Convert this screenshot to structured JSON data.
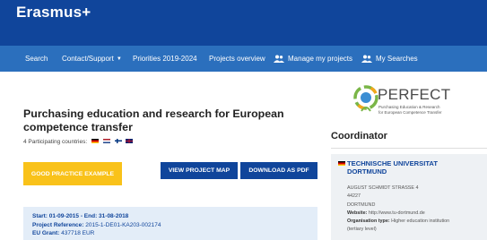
{
  "header": {
    "brand": "Erasmus+"
  },
  "nav": {
    "search": "Search",
    "contact": "Contact/Support",
    "priorities": "Priorities 2019-2024",
    "projects_overview": "Projects overview",
    "manage_projects": "Manage my projects",
    "my_searches": "My Searches"
  },
  "project": {
    "title": "Purchasing education and research for European competence transfer",
    "countries_label": "4 Participating countries:",
    "countries": [
      "de",
      "nl",
      "fi",
      "gb"
    ]
  },
  "buttons": {
    "good_practice": "GOOD PRACTICE EXAMPLE",
    "view_map": "VIEW PROJECT MAP",
    "download_pdf": "DOWNLOAD AS PDF"
  },
  "details": {
    "dates": "Start: 01-09-2015 - End: 31-08-2018",
    "reference_label": "Project Reference:",
    "reference": "2015-1-DE01-KA203-002174",
    "grant_label": "EU Grant:",
    "grant": "437718 EUR"
  },
  "logo": {
    "word": "PERFECT",
    "subtitle_1": "Purchasing Education & Research",
    "subtitle_2": "for European Competence Transfer"
  },
  "coordinator": {
    "heading": "Coordinator",
    "org_name_1": "TECHNISCHE UNIVERSITAT",
    "org_name_2": "DORTMUND",
    "street": "AUGUST SCHMIDT STRASSE 4",
    "zip": "44227",
    "city": "DORTMUND",
    "website_label": "Website:",
    "website": "http://www.tu-dortmund.de",
    "org_type_label": "Organisation type:",
    "org_type_1": "Higher education institution",
    "org_type_2": "(tertiary level)"
  },
  "colors": {
    "header": "#10459b",
    "nav": "#2b6fbd",
    "accent_yellow": "#f9c21a"
  }
}
